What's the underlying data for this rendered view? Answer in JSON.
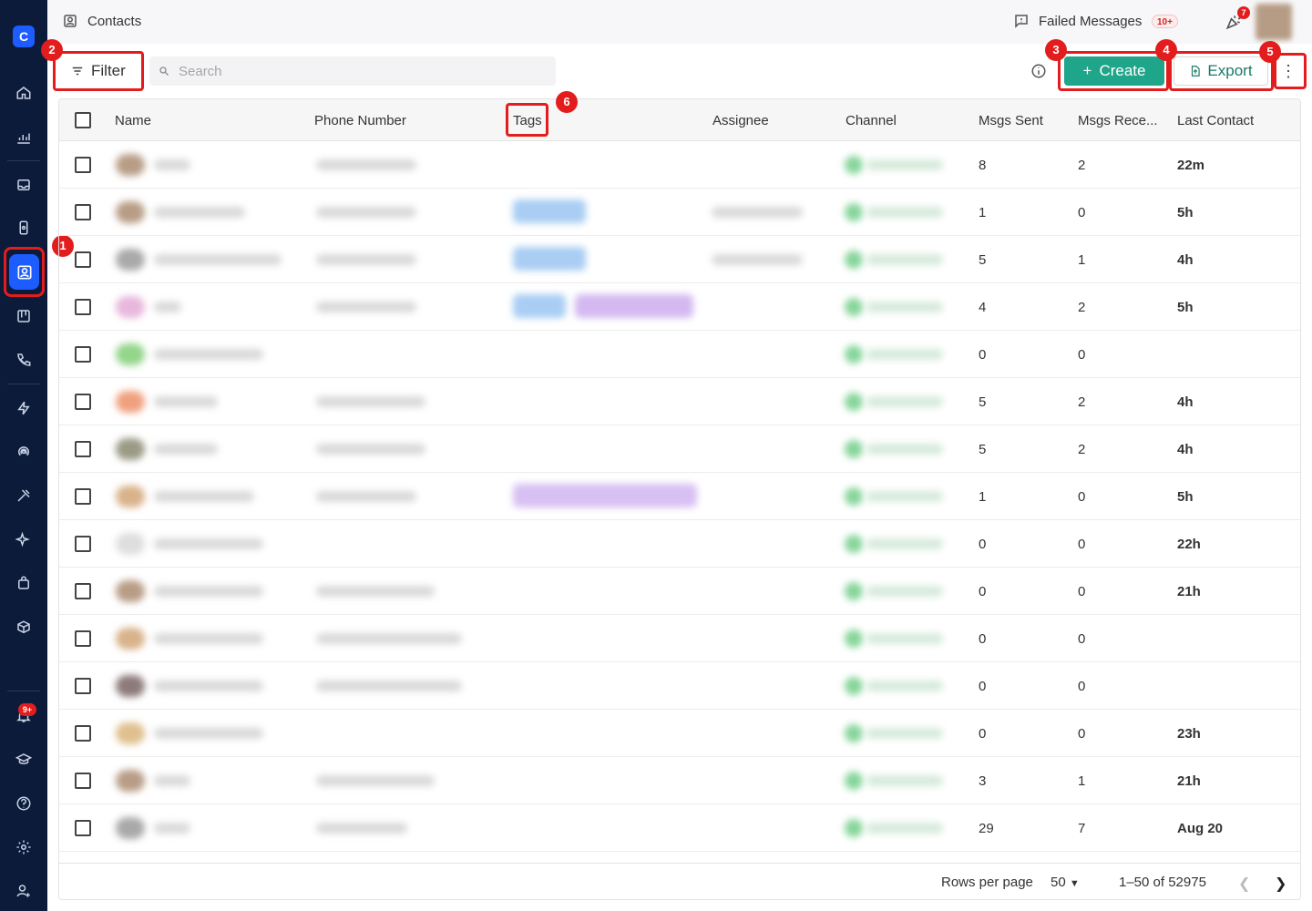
{
  "app": {
    "page_title": "Contacts"
  },
  "sidebar": {
    "logo_text": "C",
    "notification_badge": "9+",
    "items": [
      "home-icon",
      "analytics-icon",
      "inbox-icon",
      "mobile-icon",
      "contacts-icon",
      "board-icon",
      "phone-icon",
      "bolt-icon",
      "broadcast-icon",
      "tools-icon",
      "sparkle-icon",
      "bag-icon",
      "package-settings-icon",
      "bell-icon",
      "graduation-icon",
      "help-icon",
      "gear-icon",
      "user-settings-icon"
    ]
  },
  "topbar": {
    "failed_label": "Failed Messages",
    "failed_badge": "10+",
    "party_badge": "7"
  },
  "toolbar": {
    "filter_label": "Filter",
    "search_placeholder": "Search",
    "create_label": "Create",
    "export_label": "Export",
    "more_label": "⋮"
  },
  "callouts": [
    "1",
    "2",
    "3",
    "4",
    "5",
    "6"
  ],
  "table": {
    "columns": [
      "Name",
      "Phone Number",
      "Tags",
      "Assignee",
      "Channel",
      "Msgs Sent",
      "Msgs Rece...",
      "Last Contact"
    ],
    "rows": [
      {
        "sent": "8",
        "received": "2",
        "last": "22m"
      },
      {
        "sent": "1",
        "received": "0",
        "last": "5h"
      },
      {
        "sent": "5",
        "received": "1",
        "last": "4h"
      },
      {
        "sent": "4",
        "received": "2",
        "last": "5h"
      },
      {
        "sent": "0",
        "received": "0",
        "last": ""
      },
      {
        "sent": "5",
        "received": "2",
        "last": "4h"
      },
      {
        "sent": "5",
        "received": "2",
        "last": "4h"
      },
      {
        "sent": "1",
        "received": "0",
        "last": "5h"
      },
      {
        "sent": "0",
        "received": "0",
        "last": "22h"
      },
      {
        "sent": "0",
        "received": "0",
        "last": "21h"
      },
      {
        "sent": "0",
        "received": "0",
        "last": ""
      },
      {
        "sent": "0",
        "received": "0",
        "last": ""
      },
      {
        "sent": "0",
        "received": "0",
        "last": "23h"
      },
      {
        "sent": "3",
        "received": "1",
        "last": "21h"
      },
      {
        "sent": "29",
        "received": "7",
        "last": "Aug 20"
      }
    ]
  },
  "footer": {
    "rows_per_page_label": "Rows per page",
    "rows_per_page_value": "50",
    "range_label": "1–50 of 52975"
  },
  "colors": {
    "sidebar_bg": "#0c1b3a",
    "accent": "#1d5cff",
    "create_green": "#1fa58a",
    "callout_red": "#e31d1d"
  }
}
